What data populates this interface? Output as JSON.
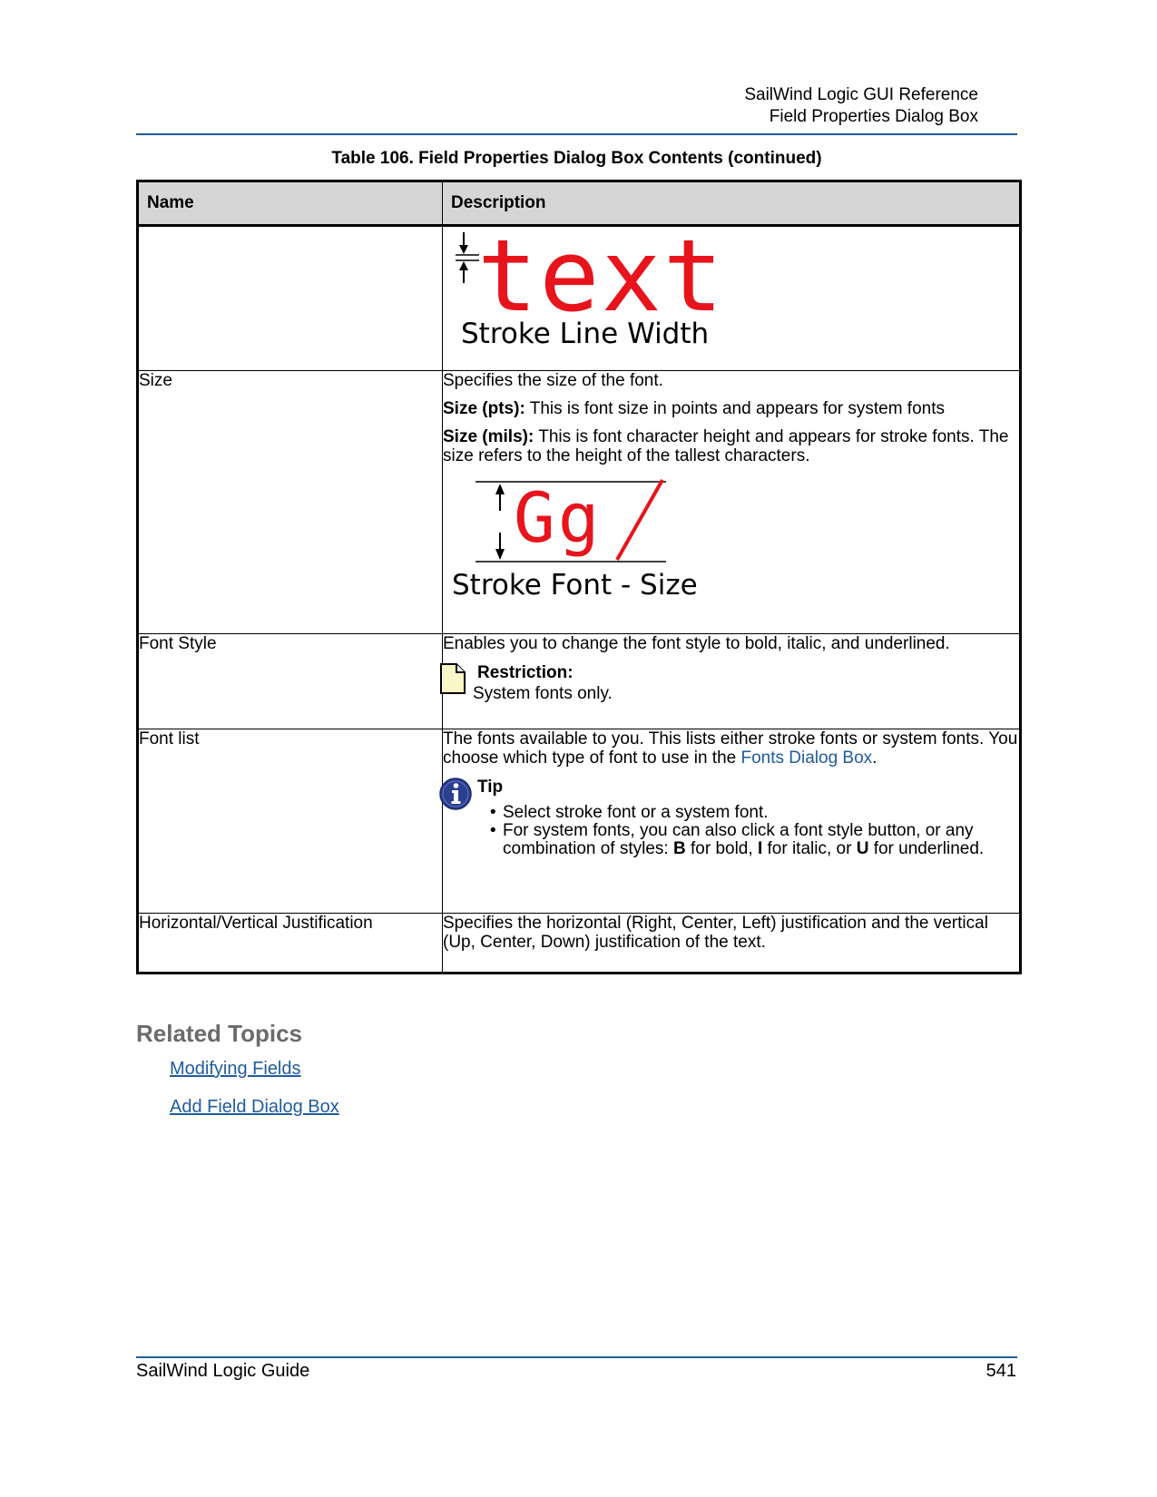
{
  "header": {
    "line1": "SailWind Logic GUI Reference",
    "line2": "Field Properties Dialog Box"
  },
  "table": {
    "caption": "Table 106. Field Properties Dialog Box Contents (continued)",
    "col_name": "Name",
    "col_desc": "Description",
    "row0": {
      "figure_word": "text",
      "figure_caption": "Stroke Line Width"
    },
    "row_size": {
      "name": "Size",
      "intro": "Specifies the size of the font.",
      "pts_label": "Size (pts):",
      "pts_text": " This is font size in points and appears for system fonts",
      "mils_label": "Size (mils):",
      "mils_text": " This is font character height and appears for stroke fonts. The size refers to the height of the tallest characters.",
      "figure_glyphs": "Gg",
      "figure_caption": "Stroke Font - Size"
    },
    "row_style": {
      "name": "Font Style",
      "desc": "Enables you to change the font style to bold, italic, and underlined.",
      "note_title": "Restriction:",
      "note_body": "System fonts only."
    },
    "row_list": {
      "name": "Font list",
      "desc_pre": "The fonts available to you. This lists either stroke fonts or system fonts. You choose which type of font to use in the ",
      "desc_link": "Fonts Dialog Box",
      "desc_post": ".",
      "tip_title": "Tip",
      "tip1": "Select stroke font or a system font.",
      "tip2_a": "For system fonts, you can also click a font style button, or any combination of styles: ",
      "tip2_b": "B",
      "tip2_c": " for bold, ",
      "tip2_d": "I",
      "tip2_e": " for italic, or ",
      "tip2_f": "U",
      "tip2_g": " for underlined."
    },
    "row_just": {
      "name": "Horizontal/Vertical Justification",
      "desc": "Specifies the horizontal (Right, Center, Left) justification and the vertical (Up, Center, Down) justification of the text."
    }
  },
  "related": {
    "heading": "Related Topics",
    "links": [
      "Modifying Fields",
      "Add Field Dialog Box"
    ]
  },
  "footer": {
    "left": "SailWind Logic Guide",
    "page": "541"
  },
  "colors": {
    "rule": "#1f5c9e",
    "link": "#1f5c9e",
    "figure_red": "#e8141c",
    "header_bg": "#d6d6d6"
  },
  "icons": [
    "note-icon",
    "info-icon",
    "arrow-down-icon",
    "arrow-up-icon"
  ]
}
